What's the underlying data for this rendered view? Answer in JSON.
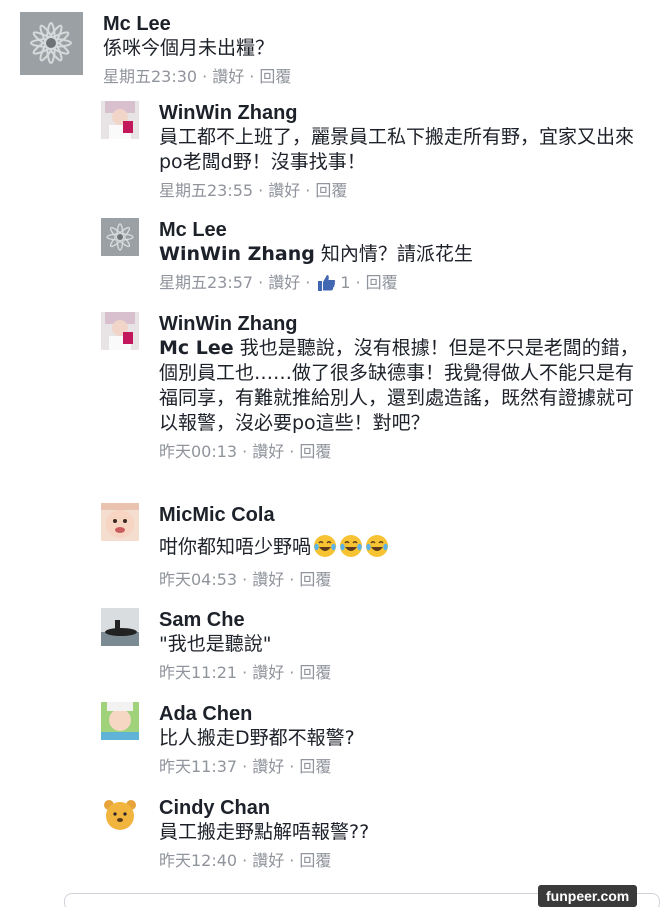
{
  "comments": [
    {
      "author": "Mc Lee",
      "avatar": "grey-flower-avatar",
      "text": "係咪今個月未出糧？",
      "time": "星期五23:30",
      "like": "讚好",
      "reply": "回覆"
    },
    {
      "author": "WinWin Zhang",
      "avatar": "pink-selfie-avatar",
      "text": "員工都不上班了，麗景員工私下搬走所有野，宜家又出來po老闆d野！沒事找事！",
      "time": "星期五23:55",
      "like": "讚好",
      "reply": "回覆"
    },
    {
      "author": "Mc Lee",
      "avatar": "grey-flower-avatar",
      "mention": "WinWin Zhang",
      "text": " 知內情？請派花生",
      "time": "星期五23:57",
      "like": "讚好",
      "like_count": "1",
      "reply": "回覆"
    },
    {
      "author": "WinWin Zhang",
      "avatar": "pink-selfie-avatar",
      "mention": "Mc Lee",
      "text": " 我也是聽說，沒有根據！但是不只是老闆的錯，個別員工也……做了很多缺德事！我覺得做人不能只是有福同享，有難就推給別人，還到處造謠，既然有證據就可以報警，沒必要po這些！對吧？",
      "time": "昨天00:13",
      "like": "讚好",
      "reply": "回覆"
    },
    {
      "author": "MicMic Cola",
      "avatar": "baby-avatar",
      "text": "咁你都知唔少野喎",
      "emoji_count": 3,
      "emoji_name": "laughing-tears-emoji",
      "time": "昨天04:53",
      "like": "讚好",
      "reply": "回覆"
    },
    {
      "author": "Sam Che",
      "avatar": "submarine-avatar",
      "text": "\"我也是聽說\"",
      "time": "昨天11:21",
      "like": "讚好",
      "reply": "回覆"
    },
    {
      "author": "Ada Chen",
      "avatar": "child-avatar",
      "text": "比人搬走D野都不報警?",
      "time": "昨天11:37",
      "like": "讚好",
      "reply": "回覆"
    },
    {
      "author": "Cindy Chan",
      "avatar": "winnie-pooh-avatar",
      "text": "員工搬走野點解唔報警??",
      "time": "昨天12:40",
      "like": "讚好",
      "reply": "回覆"
    }
  ],
  "separator": "·",
  "watermark": "funpeer.com",
  "colors": {
    "meta": "#90949c",
    "text": "#1d2129",
    "like_blue": "#4267b2"
  }
}
